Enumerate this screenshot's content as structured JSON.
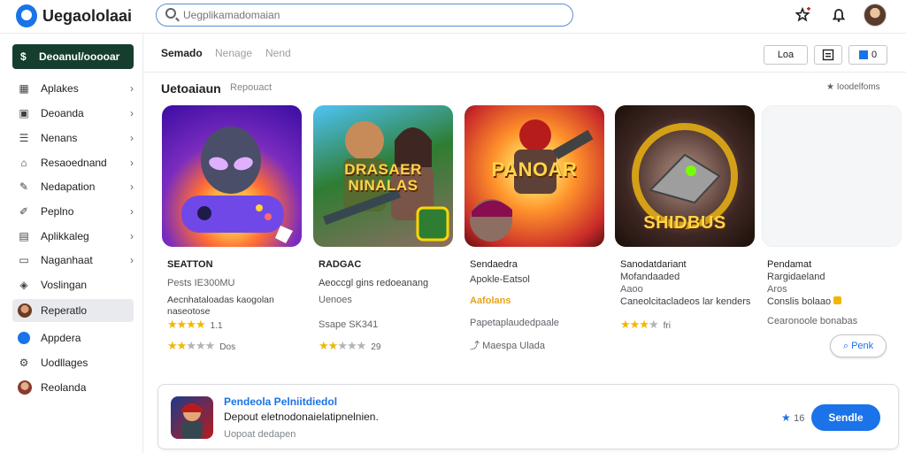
{
  "app": {
    "title": "Uegaololaai"
  },
  "search": {
    "placeholder": "Uegplikamadomaian"
  },
  "topbar": {
    "icons": [
      "star-plus-icon",
      "bell-icon",
      "avatar"
    ]
  },
  "sidebar": {
    "primary": {
      "label": "Deoanul/ooooar",
      "icon": "dollar-icon"
    },
    "items": [
      {
        "label": "Aplakes",
        "icon": "grid-icon"
      },
      {
        "label": "Deoanda",
        "icon": "briefcase-icon"
      },
      {
        "label": "Nenans",
        "icon": "list-icon"
      },
      {
        "label": "Resaoednand",
        "icon": "tag-icon"
      },
      {
        "label": "Nedapation",
        "icon": "pin-icon"
      },
      {
        "label": "Peplno",
        "icon": "pen-icon"
      },
      {
        "label": "Aplikkaleg",
        "icon": "apps-icon"
      },
      {
        "label": "Naganhaat",
        "icon": "inbox-icon"
      },
      {
        "label": "Voslingan",
        "icon": "shield-icon"
      },
      {
        "label": "Reperatlo",
        "icon": "user-avatar-icon"
      },
      {
        "label": "Appdera",
        "icon": "blue-circle-icon"
      },
      {
        "label": "Uodllages",
        "icon": "settings-icon"
      },
      {
        "label": "Reolanda",
        "icon": "profile-avatar-icon"
      }
    ]
  },
  "tabs": [
    {
      "label": "Semado"
    },
    {
      "label": "Nenage"
    },
    {
      "label": "Nend"
    }
  ],
  "header_actions": {
    "button_label": "Loa",
    "icon2": "window-icon",
    "icon3": "share-icon",
    "icon3_label": "0"
  },
  "section": {
    "title": "Uetoaiaun",
    "subtitle": "Repouact",
    "sort_label": "Ioodelfoms"
  },
  "cards": [
    {
      "thumb_text": "",
      "title": "SEATTON",
      "line1": "Pests IE300MU",
      "line2": "Aecnhataloadas kaogolan naseotose",
      "rating_mini": "1.1",
      "rating": 2,
      "rating_count": "Dos"
    },
    {
      "thumb_text": "DRASAER NINALAS",
      "title": "RADGAC",
      "line1": "Aeoccgl gins redoeanang",
      "line2": "Uenoes",
      "line3": "Ssape SK341",
      "rating": 2,
      "rating_count": "29"
    },
    {
      "thumb_text": "PANOAR",
      "title": "Sendaedra",
      "line1": "Apokle-Eatsol",
      "line2": "Aafolans",
      "line3": "Papetaplaudedpaale",
      "line4": "Maespa Ulada"
    },
    {
      "thumb_text": "SHIDBUS",
      "title": "Sanodatdariant",
      "line1": "Mofandaaded",
      "line2": "Aaoo",
      "line3": "Caneolcitacladeos lar kenders",
      "rating": 3,
      "rating_count": "fri"
    },
    {
      "title": "Pendamat",
      "line1": "Rargidaeland",
      "line2": "Aros",
      "line3": "Conslis bolaao",
      "line4": "Cearonoole bonabas"
    }
  ],
  "peek_button": {
    "label": "Penk"
  },
  "featured": {
    "title": "Pendeola Pelniitdiedol",
    "description": "Depout eletnodonaielatipnelnien.",
    "meta": "Uopoat dedapen",
    "rating": "16",
    "cta": "Sendle"
  }
}
